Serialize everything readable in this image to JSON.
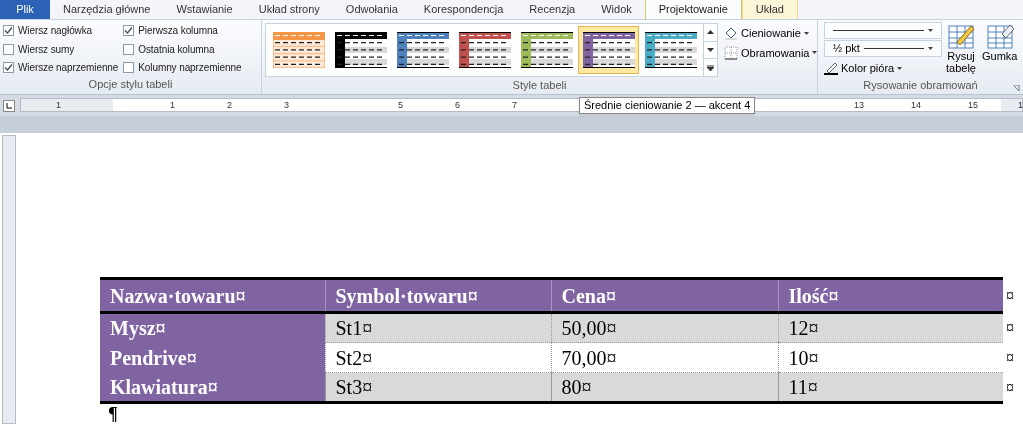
{
  "tabs": [
    {
      "label": "Plik",
      "kind": "file",
      "selected": false
    },
    {
      "label": "Narzędzia główne",
      "kind": "normal",
      "selected": false
    },
    {
      "label": "Wstawianie",
      "kind": "normal",
      "selected": false
    },
    {
      "label": "Układ strony",
      "kind": "normal",
      "selected": false
    },
    {
      "label": "Odwołania",
      "kind": "normal",
      "selected": false
    },
    {
      "label": "Korespondencja",
      "kind": "normal",
      "selected": false
    },
    {
      "label": "Recenzja",
      "kind": "normal",
      "selected": false
    },
    {
      "label": "Widok",
      "kind": "normal",
      "selected": false
    },
    {
      "label": "Projektowanie",
      "kind": "contextual",
      "selected": true
    },
    {
      "label": "Układ",
      "kind": "contextual",
      "selected": false
    }
  ],
  "style_options": {
    "group_label": "Opcje stylu tabeli",
    "options": [
      {
        "label": "Wiersz nagłówka",
        "checked": true
      },
      {
        "label": "Wiersz sumy",
        "checked": false
      },
      {
        "label": "Wiersze naprzemienne",
        "checked": true
      },
      {
        "label": "Pierwsza kolumna",
        "checked": true
      },
      {
        "label": "Ostatnia kolumna",
        "checked": false
      },
      {
        "label": "Kolumny naprzemienne",
        "checked": false
      }
    ]
  },
  "table_styles": {
    "group_label": "Style tabeli",
    "shading": "Cieniowanie",
    "borders": "Obramowania",
    "styles": [
      {
        "kind": "light",
        "color": "#f79646",
        "selected": false
      },
      {
        "kind": "medium",
        "color": "#000000",
        "selected": false
      },
      {
        "kind": "medium",
        "color": "#4f81bd",
        "selected": false
      },
      {
        "kind": "medium",
        "color": "#c0504d",
        "selected": false
      },
      {
        "kind": "medium",
        "color": "#9bbb59",
        "selected": false
      },
      {
        "kind": "medium",
        "color": "#8064a2",
        "selected": true
      },
      {
        "kind": "medium",
        "color": "#4bacc6",
        "selected": false
      }
    ]
  },
  "draw_borders": {
    "group_label": "Rysowanie obramowań",
    "line_weight": "½ pkt",
    "pen_color": "Kolor pióra",
    "draw_table": "Rysuj tabelę",
    "eraser": "Gumka"
  },
  "ruler": {
    "numbers": [
      "1",
      "1",
      "2",
      "3",
      "5",
      "6",
      "7",
      "13",
      "14",
      "15",
      "1"
    ]
  },
  "tooltip": "Średnie cieniowanie 2 — akcent 4",
  "table": {
    "columns": [
      "Nazwa·towaru¤",
      "Symbol·towaru¤",
      "Cena¤",
      "Ilość¤"
    ],
    "header_end": "¤",
    "rows": [
      {
        "cells": [
          "Mysz¤",
          "St1¤",
          "50,00¤",
          "12¤"
        ],
        "end": "¤",
        "banded": true
      },
      {
        "cells": [
          "Pendrive¤",
          "St2¤",
          "70,00¤",
          "10¤"
        ],
        "end": "¤",
        "banded": false
      },
      {
        "cells": [
          "Klawiatura¤",
          "St3¤",
          "80¤",
          "11¤"
        ],
        "end": "¤",
        "banded": true
      }
    ]
  },
  "paragraph_mark": "¶"
}
